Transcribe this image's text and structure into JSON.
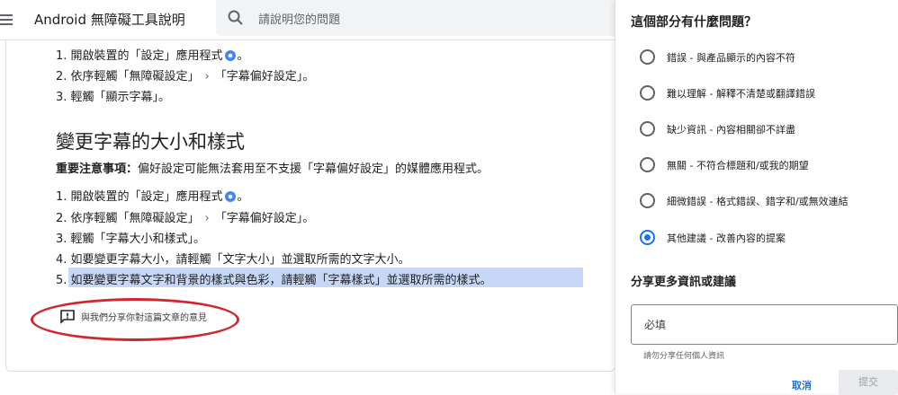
{
  "header": {
    "title": "Android 無障礙工具說明",
    "search_placeholder": "請說明您的問題"
  },
  "article": {
    "steps_top": [
      {
        "pre": "1. 開啟裝置的「設定」應用程式",
        "post": "。"
      },
      {
        "pre": "2. 依序輕觸「無障礙設定」",
        "mid": "「字幕偏好設定」。"
      },
      {
        "pre": "3. 輕觸「顯示字幕」。"
      }
    ],
    "section_title": "變更字幕的大小和樣式",
    "note_label": "重要注意事項：",
    "note_text": "偏好設定可能無法套用至不支援「字幕偏好設定」的媒體應用程式。",
    "steps_bottom": [
      {
        "pre": "1. 開啟裝置的「設定」應用程式",
        "post": "。"
      },
      {
        "pre": "2. 依序輕觸「無障礙設定」",
        "mid": "「字幕偏好設定」。"
      },
      {
        "pre": "3. 輕觸「字幕大小和樣式」。"
      },
      {
        "pre": "4. 如要變更字幕大小，請輕觸「文字大小」並選取所需的文字大小。"
      },
      {
        "pre": "5. 如要變更字幕文字和背景的樣式與色彩，請輕觸「字幕樣式」並選取所需的樣式。"
      }
    ],
    "chevron": "›",
    "feedback_link": "與我們分享你對這篇文章的意見"
  },
  "panel": {
    "title": "這個部分有什麼問題？",
    "options": [
      {
        "label": "錯誤 - 與產品顯示的內容不符",
        "checked": false
      },
      {
        "label": "難以理解 - 解釋不清楚或翻譯錯誤",
        "checked": false
      },
      {
        "label": "缺少資訊 - 內容相關卻不詳盡",
        "checked": false
      },
      {
        "label": "無關 - 不符合標題和/或我的期望",
        "checked": false
      },
      {
        "label": "細微錯誤 - 格式錯誤、錯字和/或無效連結",
        "checked": false
      },
      {
        "label": "其他建議 - 改善內容的提案",
        "checked": true
      }
    ],
    "share_title": "分享更多資訊或建議",
    "textarea_placeholder": "必填",
    "hint": "請勿分享任何個人資訊",
    "cancel_label": "取消",
    "submit_label": "提交"
  },
  "colors": {
    "accent": "#1a73e8",
    "highlight": "#c6d8f6",
    "annotation": "#d1262f"
  }
}
